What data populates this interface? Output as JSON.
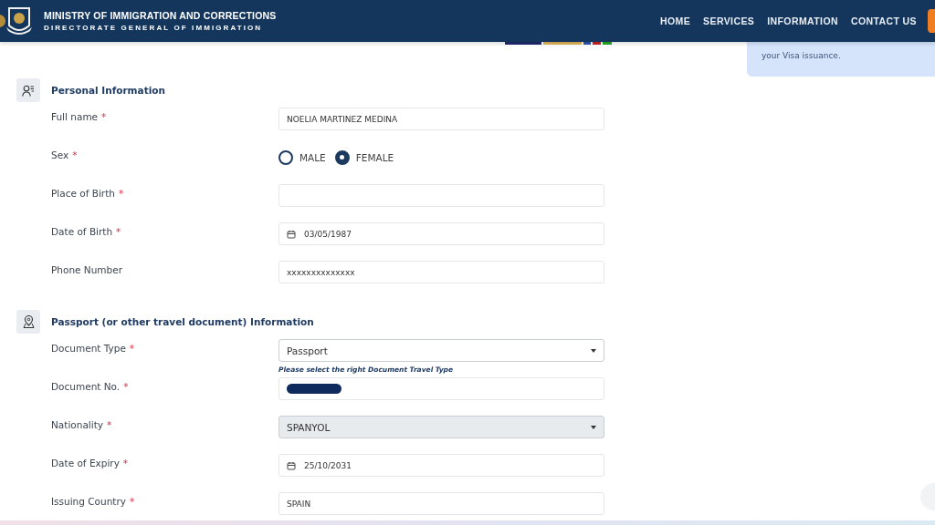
{
  "header": {
    "title": "MINISTRY OF IMMIGRATION AND CORRECTIONS",
    "subtitle": "DIRECTORATE GENERAL OF IMMIGRATION",
    "nav": [
      {
        "label": "HOME"
      },
      {
        "label": "SERVICES"
      },
      {
        "label": "INFORMATION"
      },
      {
        "label": "CONTACT US"
      }
    ]
  },
  "notice": {
    "lines": [
      "your Visa issuance."
    ]
  },
  "sections": [
    {
      "title": "Personal Information",
      "kind": "personal",
      "fields": [
        {
          "kind": "text",
          "label": "Full name",
          "mark": "*",
          "value": "NOELIA MARTINEZ MEDINA"
        },
        {
          "kind": "radio",
          "label": "Sex",
          "mark": "*",
          "options": [
            {
              "label": "MALE",
              "selected": false
            },
            {
              "label": "FEMALE",
              "selected": true
            }
          ]
        },
        {
          "kind": "text",
          "label": "Place of Birth",
          "mark": "*"
        },
        {
          "kind": "date",
          "label": "Date of Birth",
          "mark": "*",
          "value": "03/05/1987"
        },
        {
          "kind": "text",
          "label": "Phone Number",
          "value": "xxxxxxxxxxxxxx"
        }
      ]
    },
    {
      "title": "Passport (or other travel document) Information",
      "kind": "location",
      "fields": [
        {
          "kind": "select",
          "label": "Document Type",
          "mark": "*",
          "value": "Passport",
          "disabled": false,
          "hint": "Please select the right Document Travel Type"
        },
        {
          "kind": "text",
          "label": "Document No.",
          "mark": "*",
          "redacted": true
        },
        {
          "kind": "select",
          "label": "Nationality",
          "mark": "*",
          "value": "SPANYOL",
          "disabled": true
        },
        {
          "kind": "date",
          "label": "Date of Expiry",
          "mark": "*",
          "value": "25/10/2031"
        },
        {
          "kind": "text",
          "label": "Issuing Country",
          "mark": "*",
          "value": "SPAIN"
        }
      ]
    }
  ]
}
